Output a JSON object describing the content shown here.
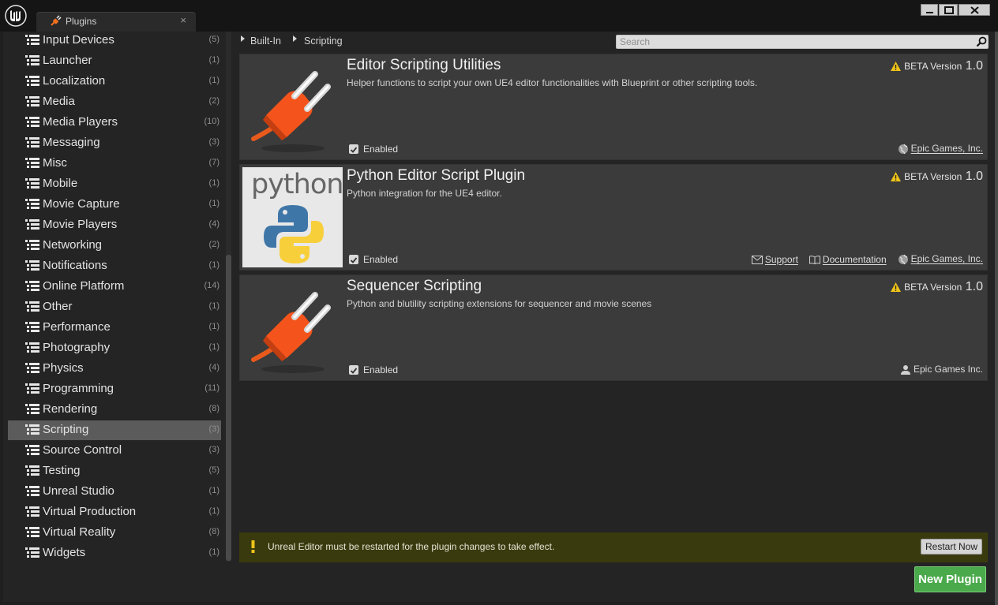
{
  "window": {
    "tab_label": "Plugins",
    "tab_close": "×",
    "colors": {
      "accent_green": "#4aa94a",
      "selected": "#5b5b5b",
      "warning_bar": "#3a3a0f",
      "warn_yellow": "#f0c419"
    }
  },
  "sidebar": {
    "items": [
      {
        "label": "Input Devices",
        "count": "(5)"
      },
      {
        "label": "Launcher",
        "count": "(1)"
      },
      {
        "label": "Localization",
        "count": "(1)"
      },
      {
        "label": "Media",
        "count": "(2)"
      },
      {
        "label": "Media Players",
        "count": "(10)"
      },
      {
        "label": "Messaging",
        "count": "(3)"
      },
      {
        "label": "Misc",
        "count": "(7)"
      },
      {
        "label": "Mobile",
        "count": "(1)"
      },
      {
        "label": "Movie Capture",
        "count": "(1)"
      },
      {
        "label": "Movie Players",
        "count": "(4)"
      },
      {
        "label": "Networking",
        "count": "(2)"
      },
      {
        "label": "Notifications",
        "count": "(1)"
      },
      {
        "label": "Online Platform",
        "count": "(14)"
      },
      {
        "label": "Other",
        "count": "(1)"
      },
      {
        "label": "Performance",
        "count": "(1)"
      },
      {
        "label": "Photography",
        "count": "(1)"
      },
      {
        "label": "Physics",
        "count": "(4)"
      },
      {
        "label": "Programming",
        "count": "(11)"
      },
      {
        "label": "Rendering",
        "count": "(8)"
      },
      {
        "label": "Scripting",
        "count": "(3)",
        "selected": true
      },
      {
        "label": "Source Control",
        "count": "(3)"
      },
      {
        "label": "Testing",
        "count": "(5)"
      },
      {
        "label": "Unreal Studio",
        "count": "(1)"
      },
      {
        "label": "Virtual Production",
        "count": "(1)"
      },
      {
        "label": "Virtual Reality",
        "count": "(8)"
      },
      {
        "label": "Widgets",
        "count": "(1)"
      }
    ]
  },
  "breadcrumb": {
    "root": "Built-In",
    "current": "Scripting"
  },
  "search": {
    "placeholder": "Search",
    "value": ""
  },
  "plugins": [
    {
      "name": "Editor Scripting Utilities",
      "description": "Helper functions to script your own UE4 editor functionalities with Blueprint or other scripting tools.",
      "beta_label": "BETA Version",
      "version": "1.0",
      "enabled_label": "Enabled",
      "enabled": true,
      "thumbnail_icon": "plug-icon",
      "vendor": "Epic Games, Inc.",
      "vendor_icon": "globe-icon"
    },
    {
      "name": "Python Editor Script Plugin",
      "description": "Python integration for the UE4 editor.",
      "beta_label": "BETA Version",
      "version": "1.0",
      "enabled_label": "Enabled",
      "enabled": true,
      "thumbnail_icon": "python-logo",
      "thumbnail_text": "python",
      "support_label": "Support",
      "documentation_label": "Documentation",
      "vendor": "Epic Games, Inc.",
      "vendor_icon": "globe-icon"
    },
    {
      "name": "Sequencer Scripting",
      "description": "Python and blutility scripting extensions for sequencer and movie scenes",
      "beta_label": "BETA Version",
      "version": "1.0",
      "enabled_label": "Enabled",
      "enabled": true,
      "thumbnail_icon": "plug-icon",
      "vendor": "Epic Games Inc.",
      "vendor_icon": "user-icon"
    }
  ],
  "restart": {
    "message": "Unreal Editor must be restarted for the plugin changes to take effect.",
    "button_label": "Restart Now"
  },
  "new_plugin_label": "New Plugin"
}
